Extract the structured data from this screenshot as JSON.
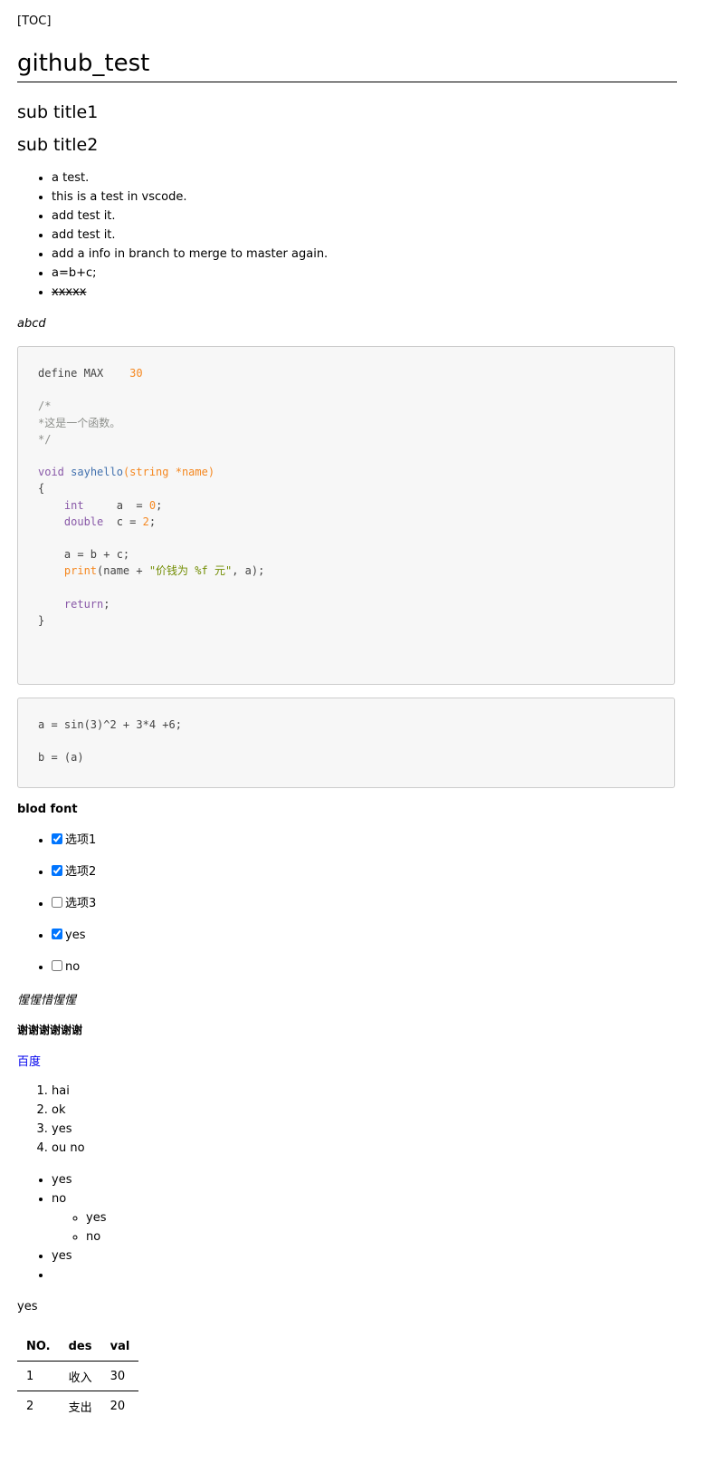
{
  "toc": "[TOC]",
  "title": "github_test",
  "sub1": "sub title1",
  "sub2": "sub title2",
  "bullets": [
    "a test.",
    "this is a test in vscode.",
    "add test it.",
    "add test it.",
    "add a info in branch to merge to master again.",
    "a=b+c;",
    "xxxxx"
  ],
  "emphasis": "abcd",
  "code1": {
    "l1a": "define MAX    ",
    "l1b": "30",
    "c1": "/*",
    "c2": "*这是一个函数。",
    "c3": "*/",
    "void": "void",
    "fn": "sayhello",
    "args": "(string *name)",
    "ob": "{",
    "int": "int",
    "ia": "     a  = ",
    "i0": "0",
    "semi": ";",
    "double": "double",
    "dc": "  c = ",
    "d2": "2",
    "abc": "    a = b + c;",
    "print": "print",
    "pn": "(name + ",
    "str": "\"价钱为 %f 元\"",
    "pe": ", a);",
    "ret": "return",
    "cb": "}"
  },
  "code2": {
    "l1": "a = sin(3)^2 + 3*4 +6;",
    "l2": "b = (a)"
  },
  "bold": "blod font",
  "tasks": [
    {
      "label": "选项1",
      "checked": true
    },
    {
      "label": "选项2",
      "checked": true
    },
    {
      "label": "选项3",
      "checked": false
    },
    {
      "label": "yes",
      "checked": true
    },
    {
      "label": "no",
      "checked": false
    }
  ],
  "italic_cn": "惺惺惜惺惺",
  "bold_cn": "谢谢谢谢谢谢",
  "link": "百度",
  "ordered": [
    "hai",
    "ok",
    "yes",
    "ou no"
  ],
  "nested": {
    "a": "yes",
    "b": "no",
    "sub": [
      "yes",
      "no"
    ],
    "c": "yes",
    "d": ""
  },
  "yes": "yes",
  "table": {
    "headers": [
      "NO.",
      "des",
      "val"
    ],
    "rows": [
      [
        "1",
        "收入",
        "30"
      ],
      [
        "2",
        "支出",
        "20"
      ]
    ]
  }
}
